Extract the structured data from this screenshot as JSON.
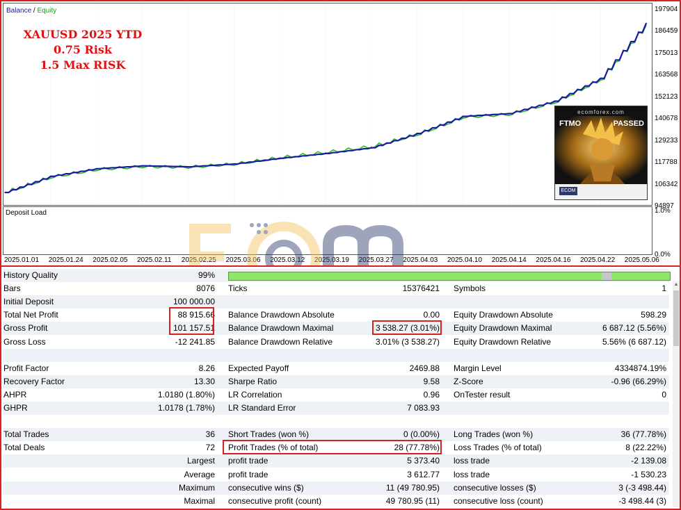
{
  "chart": {
    "legend_balance": "Balance",
    "legend_sep": " / ",
    "legend_equity": "Equity",
    "title_lines": [
      "XAUUSD 2025 YTD",
      "0.75 Risk",
      "1.5 Max RISK"
    ],
    "y_ticks": [
      "197904",
      "186459",
      "175013",
      "163568",
      "152123",
      "140678",
      "129233",
      "117788",
      "106342",
      "94897"
    ],
    "x_ticks": [
      "2025.01.01",
      "2025.01.24",
      "2025.02.05",
      "2025.02.11",
      "2025.02.25",
      "2025.03.06",
      "2025.03.12",
      "2025.03.19",
      "2025.03.27",
      "2025.04.03",
      "2025.04.10",
      "2025.04.14",
      "2025.04.16",
      "2025.04.22",
      "2025.05.06"
    ],
    "deposit_label": "Deposit Load",
    "deposit_ticks": [
      "1.0%",
      "0.0%"
    ],
    "colors": {
      "balance": "#1a1aa0",
      "equity": "#2db82d",
      "highlight": "#d92020"
    },
    "badge": {
      "site": "ecomforex.com",
      "left": "FTMO",
      "right": "PASSED",
      "logo": "ECOM"
    }
  },
  "chart_data": {
    "type": "line",
    "ylim": [
      94897,
      197904
    ],
    "x": [
      "2025.01.01",
      "2025.01.24",
      "2025.02.05",
      "2025.02.11",
      "2025.02.25",
      "2025.03.06",
      "2025.03.12",
      "2025.03.19",
      "2025.03.27",
      "2025.04.03",
      "2025.04.10",
      "2025.04.14",
      "2025.04.16",
      "2025.04.22",
      "2025.05.06"
    ],
    "series": [
      {
        "name": "Balance",
        "values": [
          100000,
          108500,
          112500,
          114000,
          113500,
          115000,
          118000,
          120500,
          123500,
          131000,
          140000,
          141500,
          148000,
          160000,
          189000
        ]
      },
      {
        "name": "Equity",
        "values": [
          100000,
          108000,
          112000,
          113500,
          113200,
          114800,
          118200,
          121000,
          124000,
          130500,
          139500,
          141000,
          147500,
          159500,
          188500
        ]
      }
    ]
  },
  "watermark": {
    "text": "ecomforex.com"
  },
  "stats": {
    "rows": [
      {
        "c1l": "History Quality",
        "c1v": "99%",
        "c2l": "",
        "c2v": "",
        "c3l": "",
        "c3v": "",
        "quality_bar": true
      },
      {
        "c1l": "Bars",
        "c1v": "8076",
        "c2l": "Ticks",
        "c2v": "15376421",
        "c3l": "Symbols",
        "c3v": "1"
      },
      {
        "c1l": "Initial Deposit",
        "c1v": "100 000.00",
        "c2l": "",
        "c2v": "",
        "c3l": "",
        "c3v": ""
      },
      {
        "c1l": "Total Net Profit",
        "c1v": "88 915.66",
        "c2l": "Balance Drawdown Absolute",
        "c2v": "0.00",
        "c3l": "Equity Drawdown Absolute",
        "c3v": "598.29"
      },
      {
        "c1l": "Gross Profit",
        "c1v": "101 157.51",
        "c2l": "Balance Drawdown Maximal",
        "c2v": "3 538.27 (3.01%)",
        "c3l": "Equity Drawdown Maximal",
        "c3v": "6 687.12 (5.56%)"
      },
      {
        "c1l": "Gross Loss",
        "c1v": "-12 241.85",
        "c2l": "Balance Drawdown Relative",
        "c2v": "3.01% (3 538.27)",
        "c3l": "Equity Drawdown Relative",
        "c3v": "5.56% (6 687.12)"
      },
      {
        "c1l": "",
        "c1v": "",
        "c2l": "",
        "c2v": "",
        "c3l": "",
        "c3v": ""
      },
      {
        "c1l": "Profit Factor",
        "c1v": "8.26",
        "c2l": "Expected Payoff",
        "c2v": "2469.88",
        "c3l": "Margin Level",
        "c3v": "4334874.19%"
      },
      {
        "c1l": "Recovery Factor",
        "c1v": "13.30",
        "c2l": "Sharpe Ratio",
        "c2v": "9.58",
        "c3l": "Z-Score",
        "c3v": "-0.96 (66.29%)"
      },
      {
        "c1l": "AHPR",
        "c1v": "1.0180 (1.80%)",
        "c2l": "LR Correlation",
        "c2v": "0.96",
        "c3l": "OnTester result",
        "c3v": "0"
      },
      {
        "c1l": "GHPR",
        "c1v": "1.0178 (1.78%)",
        "c2l": "LR Standard Error",
        "c2v": "7 083.93",
        "c3l": "",
        "c3v": ""
      },
      {
        "c1l": "",
        "c1v": "",
        "c2l": "",
        "c2v": "",
        "c3l": "",
        "c3v": ""
      },
      {
        "c1l": "Total Trades",
        "c1v": "36",
        "c2l": "Short Trades (won %)",
        "c2v": "0 (0.00%)",
        "c3l": "Long Trades (won %)",
        "c3v": "36 (77.78%)"
      },
      {
        "c1l": "Total Deals",
        "c1v": "72",
        "c2l": "Profit Trades (% of total)",
        "c2v": "28 (77.78%)",
        "c3l": "Loss Trades (% of total)",
        "c3v": "8 (22.22%)"
      },
      {
        "c1l": "",
        "c1v": "Largest",
        "c2l": "profit trade",
        "c2v": "5 373.40",
        "c3l": "loss trade",
        "c3v": "-2 139.08"
      },
      {
        "c1l": "",
        "c1v": "Average",
        "c2l": "profit trade",
        "c2v": "3 612.77",
        "c3l": "loss trade",
        "c3v": "-1 530.23"
      },
      {
        "c1l": "",
        "c1v": "Maximum",
        "c2l": "consecutive wins ($)",
        "c2v": "11 (49 780.95)",
        "c3l": "consecutive losses ($)",
        "c3v": "3 (-3 498.44)"
      },
      {
        "c1l": "",
        "c1v": "Maximal",
        "c2l": "consecutive profit (count)",
        "c2v": "49 780.95 (11)",
        "c3l": "consecutive loss (count)",
        "c3v": "-3 498.44 (3)"
      }
    ]
  }
}
